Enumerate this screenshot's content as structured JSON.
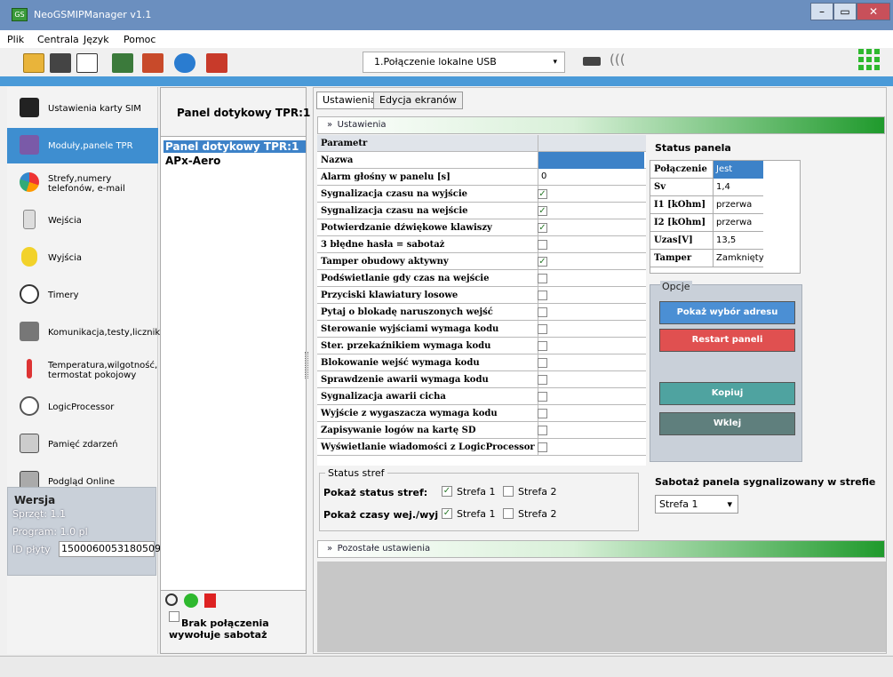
{
  "app": {
    "title": "NeoGSMIPManager v1.1",
    "icon_text": "GS"
  },
  "window_buttons": {
    "minimize": "–",
    "maximize": "▭",
    "close": "✕"
  },
  "menu": [
    "Plik",
    "Centrala",
    "Język",
    "Pomoc"
  ],
  "toolbar": {
    "connection": "1.Połączenie lokalne USB",
    "arrow": "▾",
    "signal": "((("
  },
  "sidebar": {
    "items": [
      {
        "label": "Ustawienia karty SIM",
        "icon": "sim-card-icon"
      },
      {
        "label": "Moduły,panele TPR",
        "icon": "modules-icon"
      },
      {
        "label": "Strefy,numery telefonów, e-mail",
        "icon": "zones-pie-icon"
      },
      {
        "label": "Wejścia",
        "icon": "inputs-icon"
      },
      {
        "label": "Wyjścia",
        "icon": "bulb-icon"
      },
      {
        "label": "Timery",
        "icon": "clock-icon"
      },
      {
        "label": "Komunikacja,testy,liczniki",
        "icon": "tools-icon"
      },
      {
        "label": "Temperatura,wilgotność, termostat pokojowy",
        "icon": "thermometer-icon"
      },
      {
        "label": "LogicProcessor",
        "icon": "logic-icon"
      },
      {
        "label": "Pamięć zdarzeń",
        "icon": "event-memory-icon"
      },
      {
        "label": "Podgląd Online",
        "icon": "online-view-icon"
      }
    ],
    "selected": 1
  },
  "version": {
    "title": "Wersja",
    "hardware": "Sprzęt: 1.1",
    "program": "Program: 1.0 pl",
    "board_id_label": "ID płyty",
    "board_id": "1500060053180509"
  },
  "modules": {
    "title": "Panel dotykowy TPR:1",
    "list": [
      "Panel dotykowy TPR:1",
      "APx-Aero"
    ],
    "no_connection": "Brak połączenia wywołuje sabotaż"
  },
  "tabs": [
    "Ustawienia",
    "Edycja ekranów"
  ],
  "settings_bar": {
    "icon": "»",
    "label": "Ustawienia"
  },
  "other_bar": {
    "icon": "»",
    "label": "Pozostałe ustawienia"
  },
  "grid": {
    "header": "Parametr",
    "rows": [
      {
        "name": "Nazwa",
        "value": "",
        "checked": null
      },
      {
        "name": "Alarm głośny w panelu [s]",
        "value": "0",
        "checked": null
      },
      {
        "name": "Sygnalizacja czasu na wyjście",
        "value": "",
        "checked": true
      },
      {
        "name": "Sygnalizacja czasu na wejście",
        "value": "",
        "checked": true
      },
      {
        "name": "Potwierdzanie dźwiękowe klawiszy",
        "value": "",
        "checked": true
      },
      {
        "name": "3 błędne hasła = sabotaż",
        "value": "",
        "checked": false
      },
      {
        "name": "Tamper obudowy aktywny",
        "value": "",
        "checked": true
      },
      {
        "name": "Podświetlanie gdy czas na wejście",
        "value": "",
        "checked": false
      },
      {
        "name": "Przyciski klawiatury losowe",
        "value": "",
        "checked": false
      },
      {
        "name": "Pytaj o blokadę naruszonych wejść",
        "value": "",
        "checked": false
      },
      {
        "name": "Sterowanie wyjściami wymaga kodu",
        "value": "",
        "checked": false
      },
      {
        "name": "Ster. przekaźnikiem wymaga kodu",
        "value": "",
        "checked": false
      },
      {
        "name": "Blokowanie wejść wymaga kodu",
        "value": "",
        "checked": false
      },
      {
        "name": "Sprawdzenie awarii wymaga kodu",
        "value": "",
        "checked": false
      },
      {
        "name": "Sygnalizacja awarii cicha",
        "value": "",
        "checked": false
      },
      {
        "name": "Wyjście z wygaszacza wymaga kodu",
        "value": "",
        "checked": false
      },
      {
        "name": "Zapisywanie  logów na  kartę SD",
        "value": "",
        "checked": false
      },
      {
        "name": "Wyświetlanie wiadomości z LogicProcessor",
        "value": "",
        "checked": false
      }
    ]
  },
  "panel_status": {
    "title": "Status panela",
    "rows": [
      {
        "key": "Połączenie",
        "value": "Jest"
      },
      {
        "key": "Sv",
        "value": "1,4"
      },
      {
        "key": "I1 [kOhm]",
        "value": "przerwa"
      },
      {
        "key": "I2 [kOhm]",
        "value": "przerwa"
      },
      {
        "key": "Uzas[V]",
        "value": "13,5"
      },
      {
        "key": "Tamper",
        "value": "Zamknięty"
      }
    ],
    "selected_color": "#3d82c8"
  },
  "options": {
    "title": "Opcje",
    "show_address": "Pokaż wybór adresu",
    "restart": "Restart paneli",
    "copy": "Kopiuj",
    "paste": "Wklej"
  },
  "zones": {
    "title": "Status stref",
    "show_status": "Pokaż status stref:",
    "show_times": "Pokaż czasy wej./wyj :",
    "zone1": "Strefa 1",
    "zone2": "Strefa 2",
    "status_checks": [
      true,
      false
    ],
    "time_checks": [
      true,
      false
    ]
  },
  "sabotage": {
    "label": "Sabotaż panela sygnalizowany w strefie",
    "value": "Strefa 1",
    "arrow": "▾"
  },
  "colors": {
    "selected": "#3e8ed0",
    "accent_green": "#1f9a2c",
    "restart_red": "#e05050",
    "copy_teal": "#4fa3a0"
  }
}
